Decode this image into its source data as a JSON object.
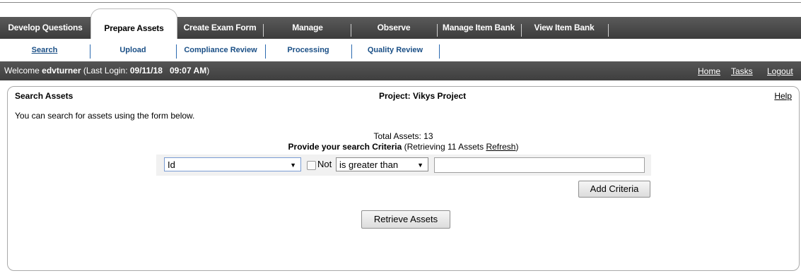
{
  "main_tabs": [
    {
      "label": "Develop Questions"
    },
    {
      "label": "Prepare Assets"
    },
    {
      "label": "Create Exam Form"
    },
    {
      "label": "Manage"
    },
    {
      "label": "Observe"
    },
    {
      "label": "Manage Item Bank"
    },
    {
      "label": "View Item Bank"
    }
  ],
  "sub_tabs": [
    {
      "label": "Search"
    },
    {
      "label": "Upload"
    },
    {
      "label": "Compliance Review"
    },
    {
      "label": "Processing"
    },
    {
      "label": "Quality Review"
    }
  ],
  "welcome": {
    "prefix": "Welcome ",
    "user": "edvturner",
    "login_prefix": " (Last Login: ",
    "login_date": "09/11/18",
    "login_time": "09:07 AM",
    "login_suffix": ")"
  },
  "top_links": {
    "home": "Home",
    "tasks": "Tasks",
    "logout": "Logout"
  },
  "panel": {
    "title": "Search Assets",
    "project": "Project: Vikys Project",
    "help": "Help",
    "description": "You can search for assets using the form below."
  },
  "search": {
    "total_assets": "Total Assets: 13",
    "criteria_title": "Provide your search Criteria",
    "retrieving_text": " (Retrieving 11 Assets ",
    "refresh": "Refresh",
    "retrieving_suffix": ")",
    "field_value": "Id",
    "not_label": "Not",
    "not_checked": false,
    "operator_value": "is greater than",
    "value_input": "",
    "add_button": "Add Criteria",
    "retrieve_button": "Retrieve Assets"
  },
  "colors": {
    "tab_bar": "#3c3c3c",
    "sub_tab_text": "#1a4f86",
    "sub_tab_separator": "#2b6ab0"
  }
}
